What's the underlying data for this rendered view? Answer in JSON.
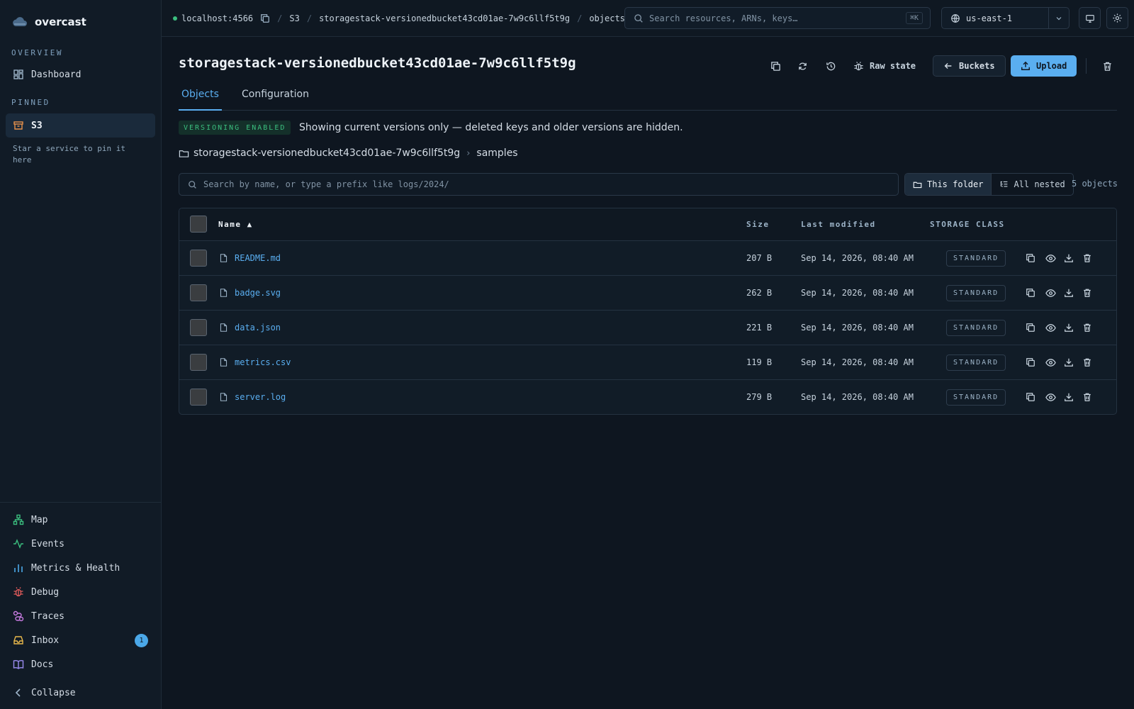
{
  "app": {
    "name": "overcast"
  },
  "sidebar": {
    "overview_label": "OVERVIEW",
    "dashboard": "Dashboard",
    "pinned_label": "PINNED",
    "pinned_item": "S3",
    "pin_hint": "Star a service to pin it here",
    "bottom": [
      {
        "label": "Map",
        "icon": "map-icon",
        "color": "#3bbf7f"
      },
      {
        "label": "Events",
        "icon": "activity-icon",
        "color": "#3bbf7f"
      },
      {
        "label": "Metrics & Health",
        "icon": "bar-chart-icon",
        "color": "#4ba8e8"
      },
      {
        "label": "Debug",
        "icon": "bug-icon",
        "color": "#e85d5d"
      },
      {
        "label": "Traces",
        "icon": "route-icon",
        "color": "#c77be0"
      },
      {
        "label": "Inbox",
        "icon": "inbox-icon",
        "color": "#e8b84b",
        "badge": "1"
      },
      {
        "label": "Docs",
        "icon": "book-icon",
        "color": "#9b8cf0"
      }
    ],
    "collapse": "Collapse"
  },
  "topbar": {
    "host": "localhost:4566",
    "crumbs": [
      "S3",
      "storagestack-versionedbucket43cd01ae-7w9c6llf5t9g",
      "objects"
    ],
    "search_placeholder": "Search resources, ARNs, keys…",
    "shortcut": "⌘K",
    "region": "us-east-1"
  },
  "page": {
    "title": "storagestack-versionedbucket43cd01ae-7w9c6llf5t9g",
    "raw_state": "Raw state",
    "buckets": "Buckets",
    "upload": "Upload",
    "tabs": [
      "Objects",
      "Configuration"
    ],
    "versioning_badge": "VERSIONING ENABLED",
    "versioning_note": "Showing current versions only — deleted keys and older versions are hidden.",
    "path": [
      "storagestack-versionedbucket43cd01ae-7w9c6llf5t9g",
      "samples"
    ],
    "filter_placeholder": "Search by name, or type a prefix like logs/2024/",
    "scope": [
      "This folder",
      "All nested"
    ],
    "count": "5 objects"
  },
  "table": {
    "headers": {
      "name": "Name ▲",
      "size": "Size",
      "modified": "Last modified",
      "class": "STORAGE CLASS"
    },
    "rows": [
      {
        "name": "README.md",
        "size": "207 B",
        "modified": "Sep 14, 2026, 08:40 AM",
        "class": "STANDARD"
      },
      {
        "name": "badge.svg",
        "size": "262 B",
        "modified": "Sep 14, 2026, 08:40 AM",
        "class": "STANDARD"
      },
      {
        "name": "data.json",
        "size": "221 B",
        "modified": "Sep 14, 2026, 08:40 AM",
        "class": "STANDARD"
      },
      {
        "name": "metrics.csv",
        "size": "119 B",
        "modified": "Sep 14, 2026, 08:40 AM",
        "class": "STANDARD"
      },
      {
        "name": "server.log",
        "size": "279 B",
        "modified": "Sep 14, 2026, 08:40 AM",
        "class": "STANDARD"
      }
    ]
  },
  "colors": {
    "accent": "#5aaef0",
    "success": "#3bbf7f",
    "background": "#0e1620"
  }
}
